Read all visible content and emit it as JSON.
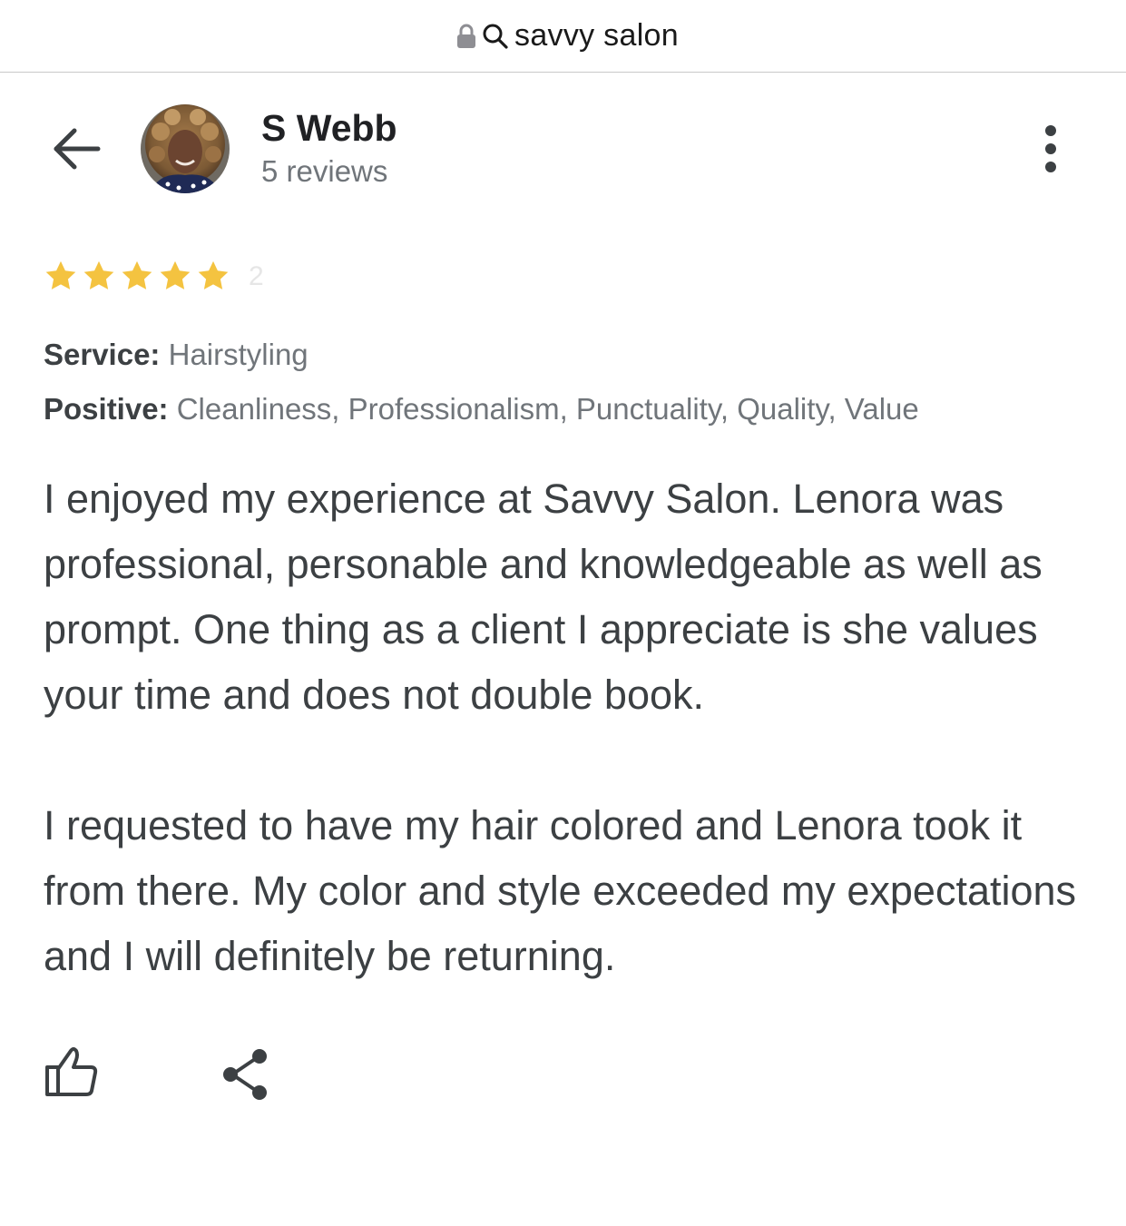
{
  "browser": {
    "url_text": "savvy salon",
    "lock_icon": "lock-icon",
    "search_icon": "search-icon"
  },
  "reviewer": {
    "name": "S Webb",
    "review_count": "5 reviews",
    "avatar": "avatar"
  },
  "review": {
    "rating": 5,
    "rating_max": 5,
    "faded_date_fragment": "2",
    "service_label": "Service:",
    "service_value": "Hairstyling",
    "positive_label": "Positive:",
    "positive_value": "Cleanliness, Professionalism, Punctuality, Quality, Value",
    "paragraphs": [
      "I enjoyed my experience at Savvy Salon. Lenora was professional, personable and knowledgeable as well as prompt. One thing as a client I appreciate is she values your time and does not double book.",
      "I requested to have my hair colored and Lenora took it from there. My color and style exceeded my expectations and I will definitely be returning."
    ]
  },
  "colors": {
    "star": "#f4c340",
    "icon": "#3c4043",
    "muted_text": "#70757a"
  },
  "icons": {
    "back": "arrow-left-icon",
    "more": "more-vertical-icon",
    "like": "thumbs-up-icon",
    "share": "share-icon"
  }
}
